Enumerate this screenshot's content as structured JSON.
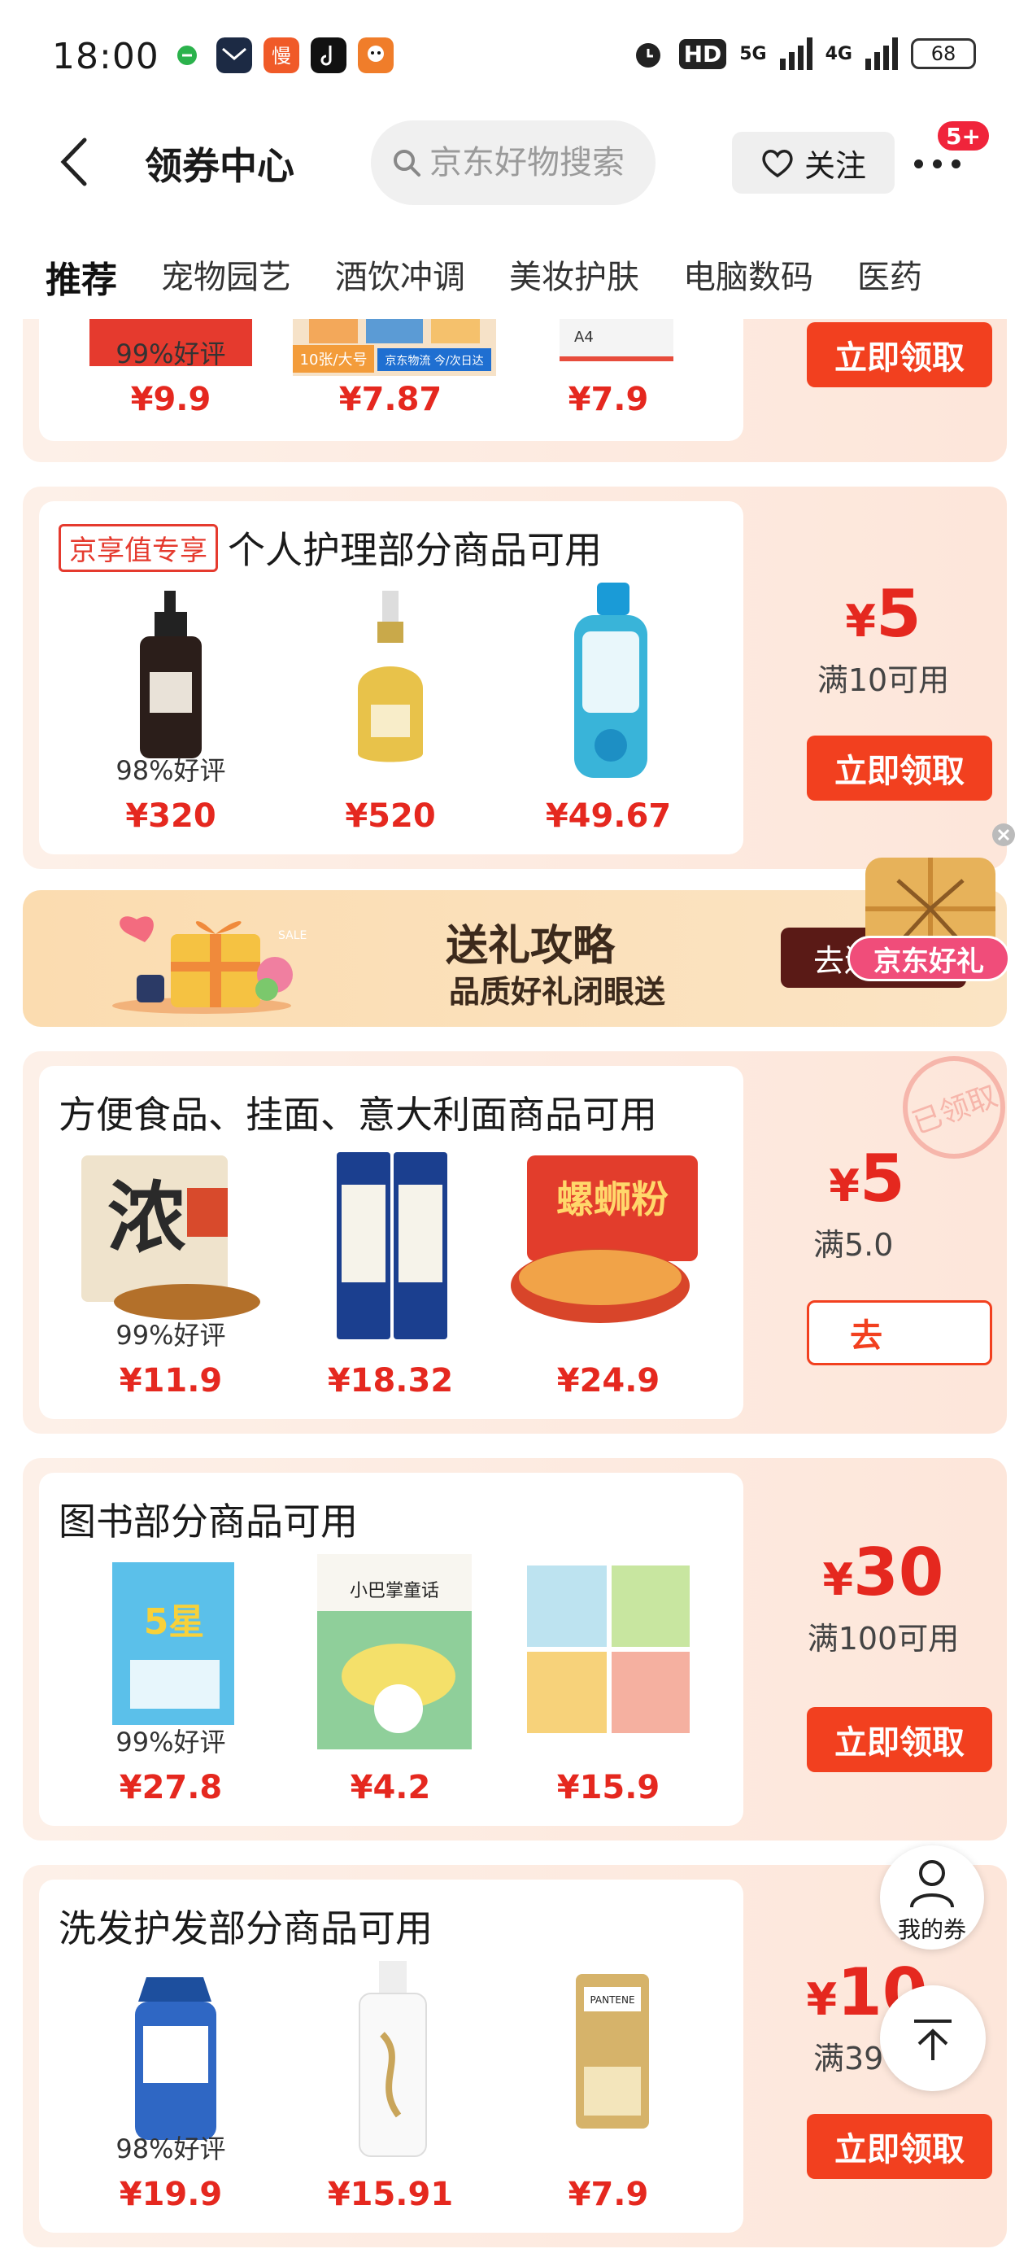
{
  "status_bar": {
    "time": "18:00",
    "battery": "68",
    "hd": "HD",
    "net1": "5G",
    "net2": "4G"
  },
  "header": {
    "title": "领券中心",
    "search_placeholder": "京东好物搜索",
    "follow_label": "关注",
    "badge": "5+"
  },
  "tabs": [
    "推荐",
    "宠物园艺",
    "酒饮冲调",
    "美妆护肤",
    "电脑数码",
    "医药"
  ],
  "coupons": [
    {
      "title": "",
      "products": [
        {
          "rating": "99%好评",
          "price": "¥9.9"
        },
        {
          "rating": "",
          "price": "¥7.87",
          "img_text": "10张/大号",
          "img_text2": "京东物流 今/次日达"
        },
        {
          "rating": "",
          "price": "¥7.9",
          "img_text": "A4"
        }
      ],
      "claim": "立即领取"
    },
    {
      "tag": "京享值专享",
      "title": "个人护理部分商品可用",
      "products": [
        {
          "rating": "98%好评",
          "price": "¥320"
        },
        {
          "rating": "",
          "price": "¥520"
        },
        {
          "rating": "",
          "price": "¥49.67"
        }
      ],
      "amount_symbol": "¥",
      "amount": "5",
      "condition": "满10可用",
      "claim": "立即领取"
    },
    {
      "title": "方便食品、挂面、意大利面商品可用",
      "products": [
        {
          "rating": "99%好评",
          "price": "¥11.9",
          "img_text": "浓"
        },
        {
          "rating": "",
          "price": "¥18.32"
        },
        {
          "rating": "",
          "price": "¥24.9",
          "img_text": "螺蛳粉"
        }
      ],
      "amount_symbol": "¥",
      "amount": "5",
      "condition": "满5.0",
      "claim": "去",
      "stamp": "已领取"
    },
    {
      "title": "图书部分商品可用",
      "products": [
        {
          "rating": "99%好评",
          "price": "¥27.8",
          "img_text": "5星"
        },
        {
          "rating": "",
          "price": "¥4.2",
          "img_text": "小巴掌童话"
        },
        {
          "rating": "",
          "price": "¥15.9"
        }
      ],
      "amount_symbol": "¥",
      "amount": "30",
      "condition": "满100可用",
      "claim": "立即领取"
    },
    {
      "title": "洗发护发部分商品可用",
      "products": [
        {
          "rating": "98%好评",
          "price": "¥19.9"
        },
        {
          "rating": "",
          "price": "¥15.91"
        },
        {
          "rating": "",
          "price": "¥7.9",
          "img_text": "PANTENE"
        }
      ],
      "amount_symbol": "¥",
      "amount": "10",
      "condition": "满39可用",
      "claim": "立即领取"
    }
  ],
  "banner": {
    "title": "送礼攻略",
    "subtitle": "品质好礼闭眼送",
    "button": "去送礼",
    "sale": "SALE"
  },
  "floating": {
    "gift_label": "京东好礼",
    "my_coupons": "我的券"
  },
  "colors": {
    "accent_red": "#e5281f",
    "claim_orange": "#f2401f",
    "coupon_bg": "#fde9de",
    "banner_bg": "#fbdcb0",
    "banner_button": "#5a1a16"
  }
}
